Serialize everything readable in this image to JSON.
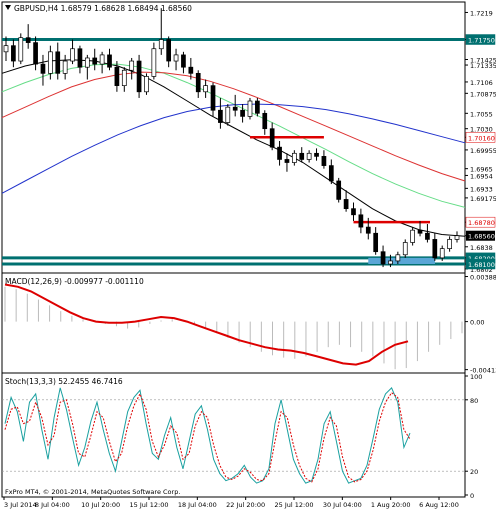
{
  "chart_data": [
    {
      "type": "candlestick",
      "title": "GBPUSD,H4  1.68579 1.68628 1.68494 1.68560",
      "x_labels": [
        "3 Jul 2014",
        "8 Jul 04:00",
        "10 Jul 20:00",
        "15 Jul 12:00",
        "18 Jul 04:00",
        "22 Jul 20:00",
        "25 Jul 12:00",
        "30 Jul 04:00",
        "1 Aug 20:00",
        "6 Aug 12:00"
      ],
      "y_ticks": [
        1.7219,
        1.7175,
        1.71425,
        1.71335,
        1.7106,
        1.70875,
        1.7055,
        1.703,
        1.7016,
        1.69955,
        1.6965,
        1.6954,
        1.6933,
        1.69175,
        1.6878,
        1.6856,
        1.6838,
        1.682,
        1.681,
        1.6802
      ],
      "ylim": [
        1.6797,
        1.7236
      ],
      "last_price": 1.6856,
      "colors": {
        "bull_body": "#ffffff",
        "bear_body": "#000000",
        "wick": "#000000"
      },
      "ohlc": [
        [
          1.7155,
          1.718,
          1.714,
          1.7165
        ],
        [
          1.7165,
          1.7175,
          1.713,
          1.714
        ],
        [
          1.714,
          1.7185,
          1.7135,
          1.7178
        ],
        [
          1.7178,
          1.72,
          1.716,
          1.717
        ],
        [
          1.717,
          1.718,
          1.7125,
          1.7135
        ],
        [
          1.7135,
          1.715,
          1.71,
          1.712
        ],
        [
          1.712,
          1.7165,
          1.711,
          1.7155
        ],
        [
          1.7155,
          1.717,
          1.711,
          1.712
        ],
        [
          1.712,
          1.715,
          1.711,
          1.714
        ],
        [
          1.714,
          1.7175,
          1.7135,
          1.716
        ],
        [
          1.716,
          1.7165,
          1.712,
          1.713
        ],
        [
          1.713,
          1.715,
          1.711,
          1.7145
        ],
        [
          1.7145,
          1.716,
          1.7125,
          1.7135
        ],
        [
          1.7135,
          1.7155,
          1.712,
          1.715
        ],
        [
          1.715,
          1.716,
          1.7125,
          1.713
        ],
        [
          1.713,
          1.714,
          1.709,
          1.71
        ],
        [
          1.71,
          1.713,
          1.709,
          1.7125
        ],
        [
          1.7125,
          1.7145,
          1.711,
          1.714
        ],
        [
          1.714,
          1.715,
          1.708,
          1.709
        ],
        [
          1.709,
          1.712,
          1.7085,
          1.7115
        ],
        [
          1.7115,
          1.717,
          1.711,
          1.716
        ],
        [
          1.716,
          1.7226,
          1.715,
          1.7175
        ],
        [
          1.7175,
          1.718,
          1.713,
          1.714
        ],
        [
          1.714,
          1.716,
          1.7125,
          1.715
        ],
        [
          1.715,
          1.7155,
          1.712,
          1.713
        ],
        [
          1.713,
          1.7145,
          1.711,
          1.712
        ],
        [
          1.712,
          1.7125,
          1.708,
          1.709
        ],
        [
          1.709,
          1.711,
          1.708,
          1.71
        ],
        [
          1.71,
          1.7105,
          1.705,
          1.706
        ],
        [
          1.706,
          1.708,
          1.703,
          1.704
        ],
        [
          1.704,
          1.707,
          1.7035,
          1.7065
        ],
        [
          1.7065,
          1.7085,
          1.705,
          1.706
        ],
        [
          1.706,
          1.707,
          1.704,
          1.705
        ],
        [
          1.705,
          1.708,
          1.7045,
          1.7075
        ],
        [
          1.7075,
          1.708,
          1.705,
          1.7055
        ],
        [
          1.7055,
          1.706,
          1.702,
          1.703
        ],
        [
          1.703,
          1.704,
          1.6995,
          1.7
        ],
        [
          1.7,
          1.701,
          1.697,
          1.698
        ],
        [
          1.698,
          1.699,
          1.696,
          1.6975
        ],
        [
          1.6975,
          1.6995,
          1.697,
          1.699
        ],
        [
          1.699,
          1.7,
          1.6975,
          1.698
        ],
        [
          1.698,
          1.6995,
          1.6975,
          1.699
        ],
        [
          1.699,
          1.6998,
          1.6978,
          1.6985
        ],
        [
          1.6985,
          1.6995,
          1.6965,
          1.697
        ],
        [
          1.697,
          1.698,
          1.694,
          1.6945
        ],
        [
          1.6945,
          1.695,
          1.691,
          1.6915
        ],
        [
          1.6915,
          1.693,
          1.6895,
          1.69
        ],
        [
          1.69,
          1.691,
          1.688,
          1.689
        ],
        [
          1.689,
          1.69,
          1.686,
          1.687
        ],
        [
          1.687,
          1.6885,
          1.685,
          1.686
        ],
        [
          1.686,
          1.687,
          1.6825,
          1.683
        ],
        [
          1.683,
          1.684,
          1.6805,
          1.681
        ],
        [
          1.681,
          1.6825,
          1.6805,
          1.6815
        ],
        [
          1.6815,
          1.683,
          1.681,
          1.6825
        ],
        [
          1.6825,
          1.685,
          1.682,
          1.6845
        ],
        [
          1.6845,
          1.687,
          1.684,
          1.6865
        ],
        [
          1.6865,
          1.688,
          1.6855,
          1.686
        ],
        [
          1.686,
          1.6875,
          1.6845,
          1.685
        ],
        [
          1.685,
          1.686,
          1.6815,
          1.682
        ],
        [
          1.682,
          1.684,
          1.6815,
          1.6835
        ],
        [
          1.6835,
          1.6855,
          1.683,
          1.685
        ],
        [
          1.685,
          1.6863,
          1.6845,
          1.6856
        ]
      ],
      "overlay_lines": [
        {
          "color": "#000000",
          "values": [
            1.712,
            1.7132,
            1.714,
            1.7142,
            1.714,
            1.7132,
            1.7118,
            1.7098,
            1.7075,
            1.7052,
            1.7032,
            1.7012,
            1.6995,
            1.6975,
            1.695,
            1.6925,
            1.69,
            1.688,
            1.6866,
            1.6858,
            1.6855
          ]
        },
        {
          "color": "#66dd88",
          "values": [
            1.709,
            1.7105,
            1.7118,
            1.7128,
            1.7134,
            1.7135,
            1.713,
            1.712,
            1.7105,
            1.7088,
            1.707,
            1.7052,
            1.7034,
            1.7015,
            1.6996,
            1.6976,
            1.6957,
            1.694,
            1.6925,
            1.6912,
            1.6902
          ]
        },
        {
          "color": "#dd3333",
          "values": [
            1.7048,
            1.7065,
            1.7082,
            1.7098,
            1.711,
            1.7118,
            1.7122,
            1.7121,
            1.7116,
            1.7107,
            1.7095,
            1.7081,
            1.7066,
            1.705,
            1.7034,
            1.7018,
            1.7002,
            1.6986,
            1.6971,
            1.6957,
            1.6945
          ]
        },
        {
          "color": "#2233cc",
          "values": [
            1.6925,
            1.6945,
            1.6965,
            1.6985,
            1.7003,
            1.702,
            1.7035,
            1.7048,
            1.7058,
            1.7065,
            1.7069,
            1.707,
            1.7069,
            1.7066,
            1.7061,
            1.7054,
            1.7046,
            1.7037,
            1.7027,
            1.7017,
            1.7007
          ]
        }
      ],
      "horizontal_levels": [
        {
          "price": 1.7175,
          "color": "#007070",
          "label": "1.71750"
        },
        {
          "price": 1.682,
          "color": "#007070",
          "label": "1.68200"
        },
        {
          "price": 1.681,
          "color": "#007070",
          "label": "1.68100"
        },
        {
          "price": 1.6878,
          "color": "#dd0000",
          "label": "1.68780"
        },
        {
          "price": 1.7016,
          "color": "#dd0000",
          "label": "1.70160"
        }
      ]
    },
    {
      "type": "line",
      "title": "MACD(12,26,9) -0.009977 -0.001110",
      "y_ticks": [
        0.003882,
        0.0,
        -0.004137
      ],
      "ylim": [
        -0.00434,
        0.0041
      ],
      "histogram": [
        0.003,
        0.0028,
        0.0024,
        0.0019,
        0.0014,
        0.0009,
        0.0005,
        0.0002,
        0.0,
        -0.0002,
        -0.0004,
        -0.0006,
        -0.0005,
        -0.0002,
        0.0001,
        0.0002,
        0.0001,
        -0.0002,
        -0.0006,
        -0.001,
        -0.0014,
        -0.0018,
        -0.0022,
        -0.0026,
        -0.0029,
        -0.0031,
        -0.0032,
        -0.003,
        -0.0026,
        -0.0022,
        -0.002,
        -0.0022,
        -0.0026,
        -0.003,
        -0.0036,
        -0.0041,
        -0.004,
        -0.0034,
        -0.0026,
        -0.002,
        -0.0015,
        -0.001
      ],
      "signal": [
        0.0032,
        0.003,
        0.0026,
        0.002,
        0.0014,
        0.0008,
        0.0003,
        0.0,
        -0.0001,
        -0.0001,
        0.0,
        0.0002,
        0.0004,
        0.0003,
        0.0,
        -0.0004,
        -0.0008,
        -0.0012,
        -0.0016,
        -0.0019,
        -0.0022,
        -0.0024,
        -0.0025,
        -0.0027,
        -0.003,
        -0.0033,
        -0.0036,
        -0.0037,
        -0.0034,
        -0.0026,
        -0.002,
        -0.0017
      ],
      "colors": {
        "histogram": "#bbbbbb",
        "signal": "#dd0000"
      }
    },
    {
      "type": "line",
      "title": "Stoch(13,3,3) 52.2455 46.7416",
      "y_ticks": [
        100,
        80,
        20,
        0
      ],
      "ylim": [
        0,
        100
      ],
      "levels": [
        80,
        20
      ],
      "main": [
        60,
        82,
        70,
        45,
        78,
        85,
        55,
        30,
        65,
        90,
        72,
        48,
        25,
        40,
        62,
        78,
        55,
        35,
        20,
        45,
        70,
        82,
        88,
        60,
        35,
        30,
        50,
        65,
        40,
        22,
        45,
        68,
        75,
        55,
        30,
        18,
        12,
        14,
        18,
        25,
        15,
        10,
        12,
        22,
        60,
        80,
        55,
        30,
        18,
        10,
        12,
        30,
        60,
        70,
        45,
        20,
        10,
        12,
        14,
        25,
        48,
        72,
        85,
        90,
        78,
        40,
        52
      ],
      "signal": [
        55,
        72,
        74,
        60,
        62,
        78,
        65,
        42,
        50,
        78,
        80,
        60,
        35,
        32,
        50,
        70,
        65,
        45,
        28,
        35,
        58,
        75,
        85,
        72,
        45,
        32,
        42,
        58,
        52,
        30,
        35,
        58,
        70,
        65,
        42,
        25,
        15,
        13,
        16,
        22,
        19,
        13,
        12,
        18,
        45,
        70,
        65,
        42,
        25,
        14,
        11,
        22,
        48,
        65,
        58,
        32,
        15,
        11,
        13,
        20,
        38,
        62,
        78,
        86,
        82,
        55,
        47
      ],
      "colors": {
        "main": "#1aa0a0",
        "signal": "#dd0000"
      }
    }
  ],
  "footer": {
    "copyright": "FxPro MT4, © 2001-2014, MetaQuotes Software Corp."
  }
}
